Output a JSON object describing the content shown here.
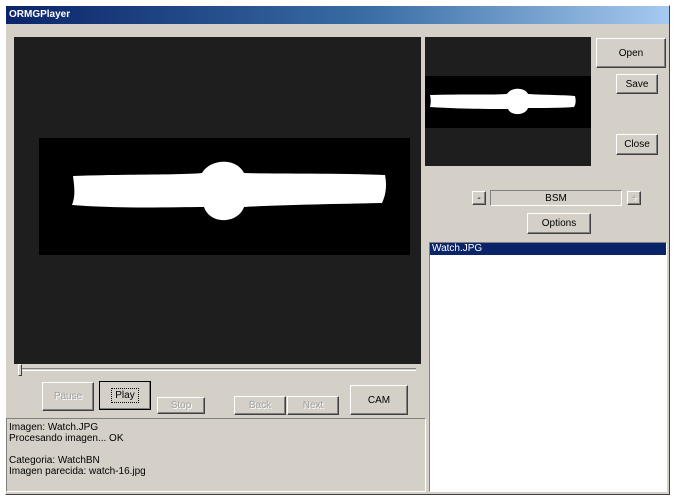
{
  "window": {
    "title": "ORMGPlayer"
  },
  "player": {
    "pause_label": "Pause",
    "play_label": "Play",
    "stop_label": "Stop",
    "back_label": "Back",
    "next_label": "Next",
    "cam_label": "CAM"
  },
  "side": {
    "open_label": "Open",
    "save_label": "Save",
    "close_label": "Close",
    "minus_label": "-",
    "plus_label": "+",
    "mode_value": "BSM",
    "options_label": "Options"
  },
  "log": {
    "lines": [
      "Imagen: Watch.JPG",
      "Procesando imagen... OK",
      "",
      "Categoria: WatchBN",
      "Imagen parecida: watch-16.jpg"
    ]
  },
  "file_list": {
    "items": [
      "Watch.JPG"
    ],
    "selected_index": 0
  },
  "colors": {
    "title_bar": "#0a246a",
    "window_bg": "#d4d0c8",
    "viewer_bg": "#1e1e1e",
    "selection": "#0a246a"
  }
}
